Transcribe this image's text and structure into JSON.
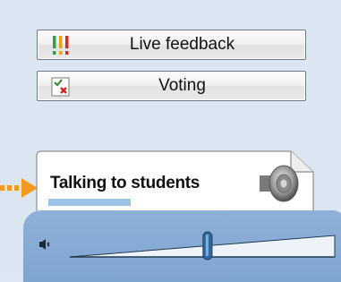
{
  "buttons": {
    "live_feedback": {
      "label": "Live feedback",
      "icon": "traffic-light-icon"
    },
    "voting": {
      "label": "Voting",
      "icon": "voting-check-cross-icon"
    }
  },
  "talking_card": {
    "title": "Talking to students",
    "icon": "speaker-icon",
    "pointer": "arrow-icon"
  },
  "volume": {
    "icon": "mute-speaker-icon",
    "level": 0.52
  },
  "colors": {
    "background": "#dce6f3",
    "volume_panel": "#8aaed6",
    "arrow": "#f29a1f",
    "progress": "#9dc3e6"
  }
}
